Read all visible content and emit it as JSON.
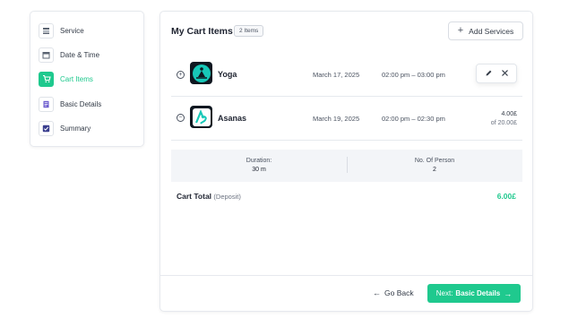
{
  "sidebar": {
    "items": [
      {
        "label": "Service",
        "icon": "list-icon",
        "active": false
      },
      {
        "label": "Date & Time",
        "icon": "calendar-icon",
        "active": false
      },
      {
        "label": "Cart Items",
        "icon": "cart-icon",
        "active": true
      },
      {
        "label": "Basic Details",
        "icon": "document-icon",
        "active": false
      },
      {
        "label": "Summary",
        "icon": "check-icon",
        "active": false
      }
    ]
  },
  "cart": {
    "title": "My Cart Items",
    "count_badge": "2 Items",
    "add_button": "Add Services",
    "items": [
      {
        "name": "Yoga",
        "date": "March 17, 2025",
        "time": "02:00 pm – 03:00 pm",
        "toggle": "+"
      },
      {
        "name": "Asanas",
        "date": "March 19, 2025",
        "time": "02:00 pm – 02:30 pm",
        "toggle": "−",
        "price": "4.00£",
        "price_sub": "of 20.00£"
      }
    ],
    "summary": {
      "duration_label": "Duration:",
      "duration_value": "30 m",
      "persons_label": "No. Of Person",
      "persons_value": "2"
    },
    "total_label": "Cart Total",
    "total_note": "(Deposit)",
    "total_value": "6.00£"
  },
  "footer": {
    "back_label": "Go Back",
    "next_prefix": "Next:",
    "next_label": "Basic Details"
  },
  "colors": {
    "accent": "#1fc98e"
  }
}
